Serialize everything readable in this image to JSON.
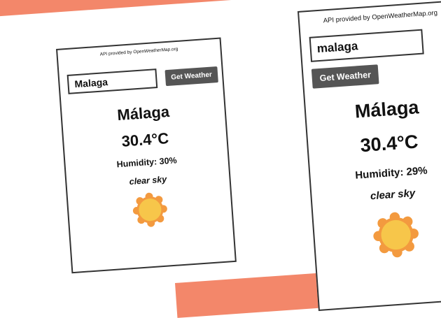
{
  "colors": {
    "banner": "#f3876a",
    "button_bg": "#555555",
    "button_text": "#ffffff",
    "border": "#333333",
    "sun_outer": "#f39a3f",
    "sun_inner": "#f7c64a"
  },
  "card1": {
    "credit": "API provided by OpenWeatherMap.org",
    "input_value": "Malaga",
    "button_label": "Get Weather",
    "city": "Málaga",
    "temperature": "30.4°C",
    "humidity": "Humidity: 30%",
    "description": "clear sky",
    "icon": "sun-icon"
  },
  "card2": {
    "credit": "API provided by OpenWeatherMap.org",
    "input_value": "malaga",
    "button_label": "Get Weather",
    "city": "Málaga",
    "temperature": "30.4°C",
    "humidity": "Humidity: 29%",
    "description": "clear sky",
    "icon": "sun-icon"
  }
}
